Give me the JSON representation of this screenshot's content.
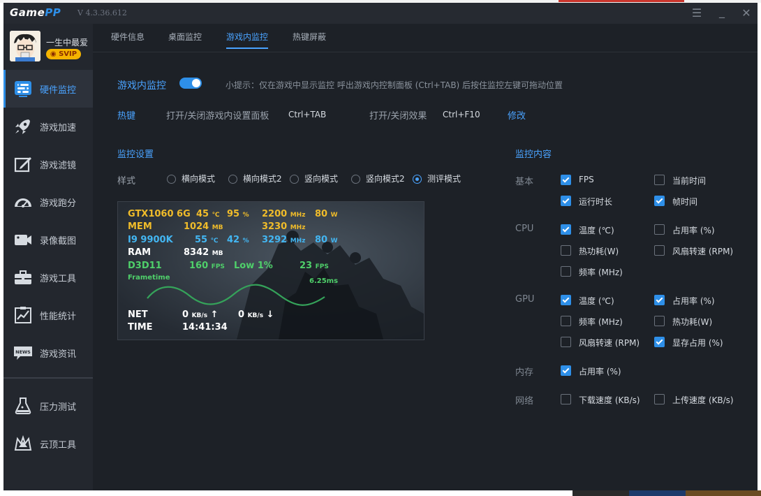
{
  "app": {
    "logo_a": "Game",
    "logo_b": "PP",
    "version": "V 4.3.36.612",
    "window_controls": [
      "menu-icon",
      "minimize-icon",
      "close-icon"
    ]
  },
  "user": {
    "name": "一生中最爱",
    "badge": "SVIP"
  },
  "sidebar": {
    "items": [
      {
        "label": "硬件监控",
        "icon": "hardware-monitor-icon"
      },
      {
        "label": "游戏加速",
        "icon": "rocket-icon"
      },
      {
        "label": "游戏滤镜",
        "icon": "filter-icon"
      },
      {
        "label": "游戏跑分",
        "icon": "speedometer-icon"
      },
      {
        "label": "录像截图",
        "icon": "camera-icon"
      },
      {
        "label": "游戏工具",
        "icon": "toolbox-icon"
      },
      {
        "label": "性能统计",
        "icon": "chart-icon"
      },
      {
        "label": "游戏资讯",
        "icon": "news-icon"
      },
      {
        "label": "压力测试",
        "icon": "flask-icon"
      },
      {
        "label": "云顶工具",
        "icon": "crown-icon"
      }
    ],
    "active_index": 0
  },
  "tabs": [
    "硬件信息",
    "桌面监控",
    "游戏内监控",
    "热键屏蔽"
  ],
  "active_tab": 2,
  "ingame": {
    "title": "游戏内监控",
    "enabled": true,
    "hint": "小提示：仅在游戏中显示监控 呼出游戏内控制面板 (Ctrl+TAB) 后按住监控左键可拖动位置"
  },
  "hotkey": {
    "label": "热键",
    "panel_label": "打开/关闭游戏内设置面板",
    "panel_key": "Ctrl+TAB",
    "effect_label": "打开/关闭效果",
    "effect_key": "Ctrl+F10",
    "modify": "修改"
  },
  "settings": {
    "title": "监控设置",
    "style_label": "样式",
    "styles": [
      "横向模式",
      "横向模式2",
      "竖向模式",
      "竖向模式2",
      "测评模式"
    ],
    "selected_style": 4
  },
  "overlay": {
    "gpu_name": "GTX1060 6G",
    "gpu_temp": "45",
    "gpu_usage": "95",
    "gpu_clock": "2200",
    "gpu_power": "80",
    "mem_label": "MEM",
    "mem_val": "1024",
    "mem_clock": "3230",
    "cpu_name": "I9 9900K",
    "cpu_temp": "55",
    "cpu_usage": "42",
    "cpu_clock": "3292",
    "cpu_power": "80",
    "ram_label": "RAM",
    "ram_val": "8342",
    "api": "D3D11",
    "fps": "160",
    "low_label": "Low 1%",
    "low_fps": "23",
    "frametime_label": "Frametime",
    "frametime_val": "6.25ms",
    "net_label": "NET",
    "net_up": "0",
    "net_down": "0",
    "time_label": "TIME",
    "time_val": "14:41:34",
    "u_c": "℃",
    "u_pct": "%",
    "u_mhz": "MHz",
    "u_w": "W",
    "u_mb": "MB",
    "u_fps": "FPS",
    "u_kbs": "KB/s",
    "up_arrow": "↑",
    "down_arrow": "↓"
  },
  "content": {
    "title": "监控内容",
    "groups": [
      {
        "name": "基本",
        "items": [
          {
            "label": "FPS",
            "checked": true
          },
          {
            "label": "当前时间",
            "checked": false
          },
          {
            "label": "运行时长",
            "checked": true
          },
          {
            "label": "帧时间",
            "checked": true
          }
        ]
      },
      {
        "name": "CPU",
        "items": [
          {
            "label": "温度 (℃)",
            "checked": true
          },
          {
            "label": "占用率 (%)",
            "checked": false
          },
          {
            "label": "热功耗(W)",
            "checked": false
          },
          {
            "label": "风扇转速 (RPM)",
            "checked": false
          },
          {
            "label": "频率 (MHz)",
            "checked": false
          }
        ]
      },
      {
        "name": "GPU",
        "items": [
          {
            "label": "温度 (℃)",
            "checked": true
          },
          {
            "label": "占用率 (%)",
            "checked": true
          },
          {
            "label": "频率 (MHz)",
            "checked": false
          },
          {
            "label": "热功耗(W)",
            "checked": false
          },
          {
            "label": "风扇转速 (RPM)",
            "checked": false
          },
          {
            "label": "显存占用 (%)",
            "checked": true
          }
        ]
      },
      {
        "name": "内存",
        "items": [
          {
            "label": "占用率 (%)",
            "checked": true
          }
        ]
      },
      {
        "name": "网络",
        "items": [
          {
            "label": "下载速度 (KB/s)",
            "checked": false
          },
          {
            "label": "上传速度 (KB/s)",
            "checked": false
          }
        ]
      }
    ]
  },
  "colors": {
    "accent": "#2e8fe8",
    "background": "#1d2127",
    "sidebar": "#23272e",
    "overlay_yellow": "#f0bc2a",
    "overlay_cyan": "#43b6f2",
    "overlay_green": "#4fd06a"
  }
}
